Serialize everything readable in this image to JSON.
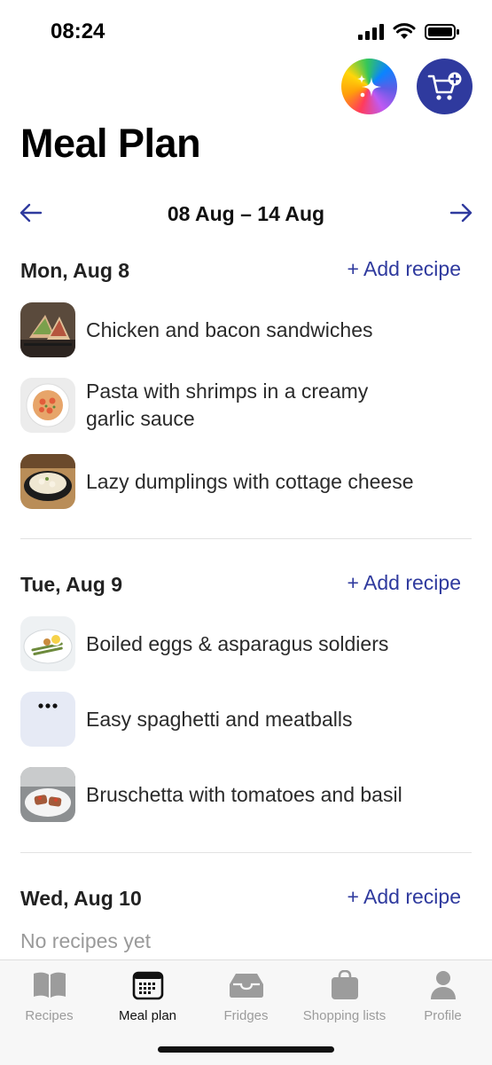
{
  "status": {
    "time": "08:24"
  },
  "header": {
    "title": "Meal Plan"
  },
  "week": {
    "range": "08 Aug – 14 Aug"
  },
  "add_label": "+ Add recipe",
  "days": [
    {
      "label": "Mon, Aug 8",
      "recipes": [
        {
          "name": "Chicken and bacon sandwiches"
        },
        {
          "name": "Pasta with shrimps in a creamy garlic sauce"
        },
        {
          "name": "Lazy dumplings with cottage cheese"
        }
      ]
    },
    {
      "label": "Tue, Aug 9",
      "recipes": [
        {
          "name": "Boiled eggs & asparagus soldiers"
        },
        {
          "name": "Easy spaghetti and meatballs"
        },
        {
          "name": "Bruschetta with tomatoes and basil"
        }
      ]
    },
    {
      "label": "Wed, Aug 10",
      "empty_text": "No recipes yet"
    }
  ],
  "tabs": [
    {
      "label": "Recipes",
      "icon": "book-icon"
    },
    {
      "label": "Meal plan",
      "icon": "calendar-icon",
      "active": true
    },
    {
      "label": "Fridges",
      "icon": "fridge-tray-icon"
    },
    {
      "label": "Shopping lists",
      "icon": "bag-icon"
    },
    {
      "label": "Profile",
      "icon": "person-icon"
    }
  ],
  "colors": {
    "accent": "#2f3a9e",
    "inactive_tab": "#9c9c9c"
  }
}
